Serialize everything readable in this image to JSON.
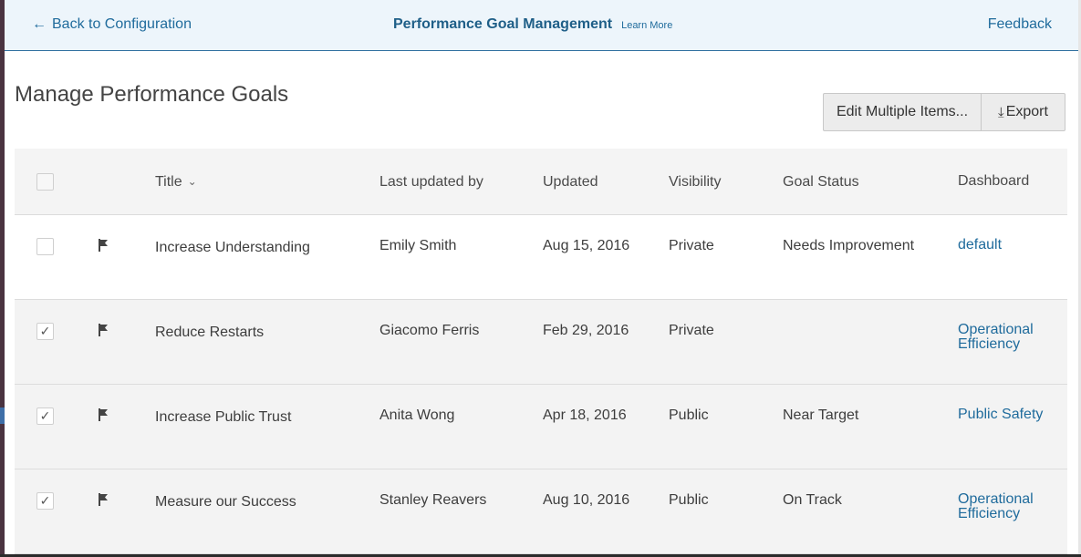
{
  "topbar": {
    "back_label": "Back to Configuration",
    "title": "Performance Goal Management",
    "learn_more": "Learn More",
    "feedback": "Feedback"
  },
  "page": {
    "title": "Manage Performance Goals"
  },
  "actions": {
    "edit_multiple": "Edit Multiple Items...",
    "export": "Export"
  },
  "table": {
    "headers": {
      "title": "Title",
      "last_updated_by": "Last updated by",
      "updated": "Updated",
      "visibility": "Visibility",
      "goal_status": "Goal Status",
      "dashboard": "Dashboard"
    },
    "rows": [
      {
        "checked": false,
        "title": "Increase Understanding",
        "last_updated_by": "Emily Smith",
        "updated": "Aug 15, 2016",
        "visibility": "Private",
        "goal_status": "Needs Improvement",
        "dashboard": "default"
      },
      {
        "checked": true,
        "title": "Reduce Restarts",
        "last_updated_by": "Giacomo Ferris",
        "updated": "Feb 29, 2016",
        "visibility": "Private",
        "goal_status": "",
        "dashboard": "Operational Efficiency"
      },
      {
        "checked": true,
        "title": "Increase Public Trust",
        "last_updated_by": "Anita Wong",
        "updated": "Apr 18, 2016",
        "visibility": "Public",
        "goal_status": "Near Target",
        "dashboard": "Public Safety"
      },
      {
        "checked": true,
        "title": "Measure our Success",
        "last_updated_by": "Stanley Reavers",
        "updated": "Aug 10, 2016",
        "visibility": "Public",
        "goal_status": "On Track",
        "dashboard": "Operational Efficiency"
      }
    ]
  },
  "colors": {
    "accent": "#1f6b9c",
    "topbar_bg": "#edf5fb"
  },
  "icons": {
    "back": "arrow-left-icon",
    "sort": "chevron-down-icon",
    "export": "download-icon",
    "row_flag": "flag-icon",
    "check": "checkmark-icon"
  }
}
